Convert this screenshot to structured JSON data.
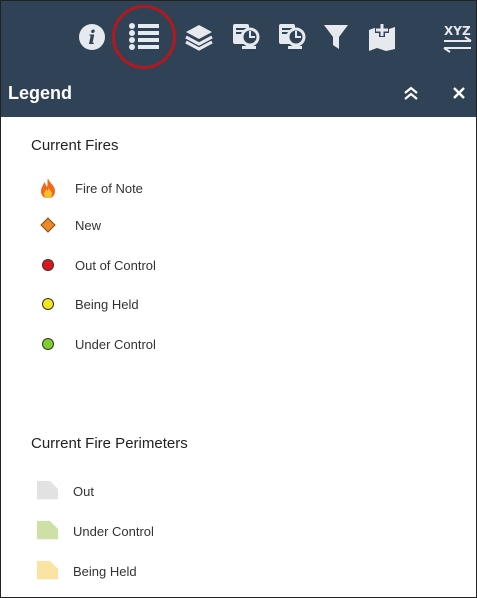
{
  "toolbar": {
    "buttons": [
      {
        "name": "info",
        "icon": "info-icon"
      },
      {
        "name": "legend",
        "icon": "legend-list-icon",
        "highlighted": true
      },
      {
        "name": "layers",
        "icon": "layers-icon"
      },
      {
        "name": "query-1",
        "icon": "query-report-icon"
      },
      {
        "name": "query-2",
        "icon": "query-report-icon"
      },
      {
        "name": "filter",
        "icon": "filter-icon"
      },
      {
        "name": "add-data",
        "icon": "add-data-icon"
      },
      {
        "name": "coordinates",
        "icon": "xyz-coordinate-icon"
      }
    ],
    "xyz_label": "XYZ"
  },
  "panel": {
    "title": "Legend",
    "collapse_icon": "double-chevron-up-icon",
    "close_icon": "close-icon"
  },
  "legend": {
    "sections": [
      {
        "title": "Current Fires",
        "items": [
          {
            "label": "Fire of Note",
            "symbol": "flame-icon"
          },
          {
            "label": "New",
            "symbol": "diamond",
            "color": "#e8892b"
          },
          {
            "label": "Out of Control",
            "symbol": "circle",
            "color": "#e0161c"
          },
          {
            "label": "Being Held",
            "symbol": "circle",
            "color": "#f5e61c"
          },
          {
            "label": "Under Control",
            "symbol": "circle",
            "color": "#7fcf2a"
          }
        ]
      },
      {
        "title": "Current Fire Perimeters",
        "items": [
          {
            "label": "Out",
            "symbol": "polygon",
            "color": "#e2e2e2"
          },
          {
            "label": "Under Control",
            "symbol": "polygon",
            "color": "#cfe0a6"
          },
          {
            "label": "Being Held",
            "symbol": "polygon",
            "color": "#fbe4a2"
          }
        ]
      }
    ]
  },
  "colors": {
    "header_bg": "#2f4256",
    "highlight_ring": "#b3191c",
    "icon": "#e6e9ed"
  }
}
